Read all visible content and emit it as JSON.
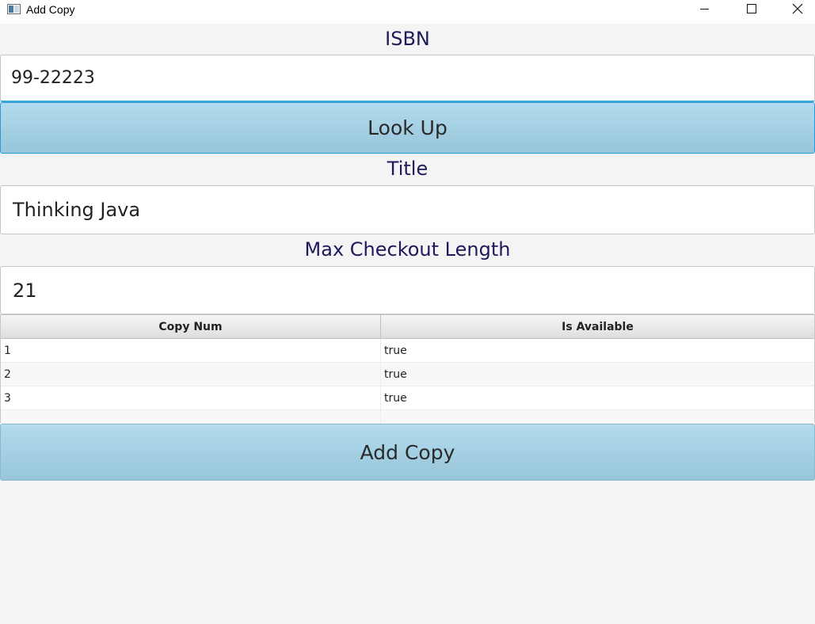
{
  "window": {
    "title": "Add Copy",
    "icon": "app-window-icon",
    "controls": [
      "minimize-icon",
      "maximize-icon",
      "close-icon"
    ]
  },
  "form": {
    "isbn_label": "ISBN",
    "isbn_value": "99-22223",
    "lookup_label": "Look Up",
    "title_label": "Title",
    "title_value": "Thinking Java",
    "max_label": "Max Checkout Length",
    "max_value": "21",
    "add_copy_label": "Add Copy"
  },
  "table": {
    "columns": [
      "Copy Num",
      "Is Available"
    ],
    "rows": [
      [
        "1",
        "true"
      ],
      [
        "2",
        "true"
      ],
      [
        "3",
        "true"
      ]
    ]
  },
  "colors": {
    "label_text": "#1e1a5c",
    "button_bg": "#a7d2e6",
    "focus_border": "#2a9bd6",
    "background": "#f4f4f4"
  }
}
